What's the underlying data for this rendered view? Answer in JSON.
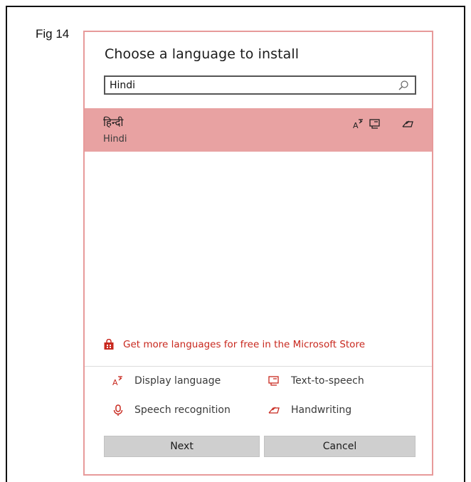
{
  "figure": {
    "label": "Fig 14"
  },
  "dialog": {
    "title": "Choose a language to install",
    "search": {
      "value": "Hindi",
      "icon": "search-icon"
    },
    "results": [
      {
        "native_name": "हिन्दी",
        "english_name": "Hindi",
        "features": [
          "display-language-icon",
          "text-to-speech-icon",
          "handwriting-icon"
        ],
        "selected": true
      }
    ],
    "store_link": {
      "label": "Get more languages for free in the Microsoft Store",
      "icon": "store-bag-icon"
    },
    "legend": [
      {
        "icon": "display-language-icon",
        "label": "Display language"
      },
      {
        "icon": "text-to-speech-icon",
        "label": "Text-to-speech"
      },
      {
        "icon": "speech-recognition-icon",
        "label": "Speech recognition"
      },
      {
        "icon": "handwriting-icon",
        "label": "Handwriting"
      }
    ],
    "buttons": {
      "next": "Next",
      "cancel": "Cancel"
    }
  },
  "colors": {
    "selected_row": "#e8a2a2",
    "accent_red": "#c8281e",
    "dialog_border": "#e79a9a",
    "button_bg": "#cfcfcf"
  }
}
